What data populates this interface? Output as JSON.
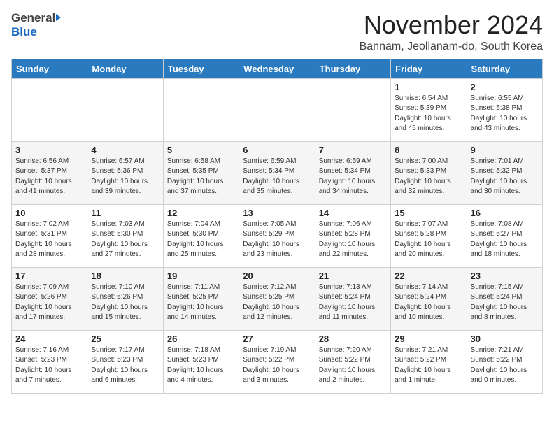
{
  "header": {
    "logo_general": "General",
    "logo_blue": "Blue",
    "month_title": "November 2024",
    "location": "Bannam, Jeollanam-do, South Korea"
  },
  "days_of_week": [
    "Sunday",
    "Monday",
    "Tuesday",
    "Wednesday",
    "Thursday",
    "Friday",
    "Saturday"
  ],
  "weeks": [
    [
      {
        "day": "",
        "info": ""
      },
      {
        "day": "",
        "info": ""
      },
      {
        "day": "",
        "info": ""
      },
      {
        "day": "",
        "info": ""
      },
      {
        "day": "",
        "info": ""
      },
      {
        "day": "1",
        "info": "Sunrise: 6:54 AM\nSunset: 5:39 PM\nDaylight: 10 hours\nand 45 minutes."
      },
      {
        "day": "2",
        "info": "Sunrise: 6:55 AM\nSunset: 5:38 PM\nDaylight: 10 hours\nand 43 minutes."
      }
    ],
    [
      {
        "day": "3",
        "info": "Sunrise: 6:56 AM\nSunset: 5:37 PM\nDaylight: 10 hours\nand 41 minutes."
      },
      {
        "day": "4",
        "info": "Sunrise: 6:57 AM\nSunset: 5:36 PM\nDaylight: 10 hours\nand 39 minutes."
      },
      {
        "day": "5",
        "info": "Sunrise: 6:58 AM\nSunset: 5:35 PM\nDaylight: 10 hours\nand 37 minutes."
      },
      {
        "day": "6",
        "info": "Sunrise: 6:59 AM\nSunset: 5:34 PM\nDaylight: 10 hours\nand 35 minutes."
      },
      {
        "day": "7",
        "info": "Sunrise: 6:59 AM\nSunset: 5:34 PM\nDaylight: 10 hours\nand 34 minutes."
      },
      {
        "day": "8",
        "info": "Sunrise: 7:00 AM\nSunset: 5:33 PM\nDaylight: 10 hours\nand 32 minutes."
      },
      {
        "day": "9",
        "info": "Sunrise: 7:01 AM\nSunset: 5:32 PM\nDaylight: 10 hours\nand 30 minutes."
      }
    ],
    [
      {
        "day": "10",
        "info": "Sunrise: 7:02 AM\nSunset: 5:31 PM\nDaylight: 10 hours\nand 28 minutes."
      },
      {
        "day": "11",
        "info": "Sunrise: 7:03 AM\nSunset: 5:30 PM\nDaylight: 10 hours\nand 27 minutes."
      },
      {
        "day": "12",
        "info": "Sunrise: 7:04 AM\nSunset: 5:30 PM\nDaylight: 10 hours\nand 25 minutes."
      },
      {
        "day": "13",
        "info": "Sunrise: 7:05 AM\nSunset: 5:29 PM\nDaylight: 10 hours\nand 23 minutes."
      },
      {
        "day": "14",
        "info": "Sunrise: 7:06 AM\nSunset: 5:28 PM\nDaylight: 10 hours\nand 22 minutes."
      },
      {
        "day": "15",
        "info": "Sunrise: 7:07 AM\nSunset: 5:28 PM\nDaylight: 10 hours\nand 20 minutes."
      },
      {
        "day": "16",
        "info": "Sunrise: 7:08 AM\nSunset: 5:27 PM\nDaylight: 10 hours\nand 18 minutes."
      }
    ],
    [
      {
        "day": "17",
        "info": "Sunrise: 7:09 AM\nSunset: 5:26 PM\nDaylight: 10 hours\nand 17 minutes."
      },
      {
        "day": "18",
        "info": "Sunrise: 7:10 AM\nSunset: 5:26 PM\nDaylight: 10 hours\nand 15 minutes."
      },
      {
        "day": "19",
        "info": "Sunrise: 7:11 AM\nSunset: 5:25 PM\nDaylight: 10 hours\nand 14 minutes."
      },
      {
        "day": "20",
        "info": "Sunrise: 7:12 AM\nSunset: 5:25 PM\nDaylight: 10 hours\nand 12 minutes."
      },
      {
        "day": "21",
        "info": "Sunrise: 7:13 AM\nSunset: 5:24 PM\nDaylight: 10 hours\nand 11 minutes."
      },
      {
        "day": "22",
        "info": "Sunrise: 7:14 AM\nSunset: 5:24 PM\nDaylight: 10 hours\nand 10 minutes."
      },
      {
        "day": "23",
        "info": "Sunrise: 7:15 AM\nSunset: 5:24 PM\nDaylight: 10 hours\nand 8 minutes."
      }
    ],
    [
      {
        "day": "24",
        "info": "Sunrise: 7:16 AM\nSunset: 5:23 PM\nDaylight: 10 hours\nand 7 minutes."
      },
      {
        "day": "25",
        "info": "Sunrise: 7:17 AM\nSunset: 5:23 PM\nDaylight: 10 hours\nand 6 minutes."
      },
      {
        "day": "26",
        "info": "Sunrise: 7:18 AM\nSunset: 5:23 PM\nDaylight: 10 hours\nand 4 minutes."
      },
      {
        "day": "27",
        "info": "Sunrise: 7:19 AM\nSunset: 5:22 PM\nDaylight: 10 hours\nand 3 minutes."
      },
      {
        "day": "28",
        "info": "Sunrise: 7:20 AM\nSunset: 5:22 PM\nDaylight: 10 hours\nand 2 minutes."
      },
      {
        "day": "29",
        "info": "Sunrise: 7:21 AM\nSunset: 5:22 PM\nDaylight: 10 hours\nand 1 minute."
      },
      {
        "day": "30",
        "info": "Sunrise: 7:21 AM\nSunset: 5:22 PM\nDaylight: 10 hours\nand 0 minutes."
      }
    ]
  ]
}
